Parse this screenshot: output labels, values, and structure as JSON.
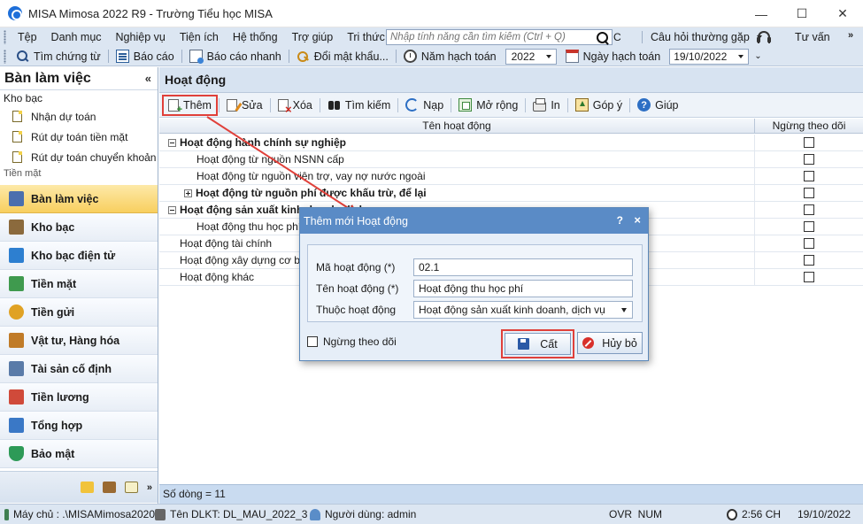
{
  "window": {
    "title": "MISA Mimosa 2022 R9 - Trường Tiểu học MISA",
    "controls": [
      "—",
      "☐",
      "✕"
    ]
  },
  "menubar": {
    "items": [
      "Tệp",
      "Danh mục",
      "Nghiệp vụ",
      "Tiện ích",
      "Hệ thống",
      "Trợ giúp",
      "Tri thức"
    ],
    "search_placeholder": "Nhập tính năng cần tìm kiếm (Ctrl + Q)",
    "c_label": "C",
    "faq_label": "Câu hỏi thường gặp",
    "advisor_label": "Tư vấn",
    "overflow": "»"
  },
  "toolbar2": {
    "find_voucher": "Tìm chứng từ",
    "report": "Báo cáo",
    "quick_report": "Báo cáo nhanh",
    "change_password": "Đổi mật khẩu...",
    "fiscal_year_label": "Năm hạch toán",
    "fiscal_year_value": "2022",
    "posting_date_label": "Ngày hạch toán",
    "posting_date_value": "19/10/2022",
    "more": "⌄"
  },
  "left_panel": {
    "title": "Bàn làm việc",
    "collapse": "«",
    "group": "Kho bạc",
    "links": [
      "Nhận dự toán",
      "Rút dự toán tiền mặt",
      "Rút dự toán chuyển khoản"
    ],
    "cut_item": "Tiền mặt",
    "nav": [
      "Bàn làm việc",
      "Kho bạc",
      "Kho bạc điện tử",
      "Tiền mặt",
      "Tiền gửi",
      "Vật tư, Hàng hóa",
      "Tài sản cố định",
      "Tiền lương",
      "Tổng hợp",
      "Bảo mật"
    ],
    "active_nav": "Bàn làm việc",
    "more": "»"
  },
  "main": {
    "title": "Hoạt động",
    "toolbar": {
      "add": "Thêm",
      "edit": "Sửa",
      "delete": "Xóa",
      "search": "Tìm kiếm",
      "reload": "Nạp",
      "expand": "Mở rộng",
      "print": "In",
      "suggest": "Góp ý",
      "help": "Giúp"
    },
    "columns": {
      "name": "Tên hoạt động",
      "stopped": "Ngừng theo dõi"
    },
    "rows": [
      {
        "name": "Hoạt động hành chính sự nghiệp",
        "level": 0,
        "bold": true,
        "toggle": "minus",
        "stopped": false
      },
      {
        "name": "Hoạt động từ nguồn NSNN cấp",
        "level": 1,
        "bold": false,
        "toggle": "",
        "stopped": false
      },
      {
        "name": "Hoạt động từ nguồn viện trợ, vay nợ nước ngoài",
        "level": 1,
        "bold": false,
        "toggle": "",
        "stopped": false
      },
      {
        "name": "Hoạt động từ nguồn phí được khấu trừ, để lại",
        "level": 1,
        "bold": true,
        "toggle": "plus",
        "stopped": false
      },
      {
        "name": "Hoạt động sản xuất kinh doanh, dịch vụ",
        "level": 0,
        "bold": true,
        "toggle": "minus",
        "stopped": false
      },
      {
        "name": "Hoạt động thu học phí",
        "level": 1,
        "bold": false,
        "toggle": "",
        "stopped": false
      },
      {
        "name": "Hoạt động tài chính",
        "level": 0,
        "bold": false,
        "toggle": "",
        "stopped": false
      },
      {
        "name": "Hoạt động xây dựng cơ bản",
        "level": 0,
        "bold": false,
        "toggle": "",
        "stopped": false
      },
      {
        "name": "Hoạt động khác",
        "level": 0,
        "bold": false,
        "toggle": "",
        "stopped": false
      }
    ],
    "row_count": "Số dòng = 11"
  },
  "dialog": {
    "title": "Thêm mới Hoạt động",
    "help": "?",
    "close": "×",
    "fields": {
      "code_label": "Mã hoạt động (*)",
      "code_value": "02.1",
      "name_label": "Tên hoạt động (*)",
      "name_value": "Hoạt động thu học phí",
      "parent_label": "Thuộc hoạt động",
      "parent_value": "Hoạt động sản xuất kinh doanh, dịch vụ"
    },
    "stop_tracking_label": "Ngừng theo dõi",
    "save": "Cất",
    "cancel": "Hủy bỏ"
  },
  "statusbar": {
    "server": "Máy chủ : .\\MISAMimosa2020",
    "database": "Tên DLKT: DL_MAU_2022_3",
    "user": "Người dùng: admin",
    "mode": "OVR  NUM",
    "time": "2:56 CH",
    "date": "19/10/2022"
  },
  "colors": {
    "highlight": "#e0403a",
    "dialog_title": "#5a8bc6",
    "active_nav": "#f8cf5f",
    "toolbar_bg": "#dce6f2"
  }
}
